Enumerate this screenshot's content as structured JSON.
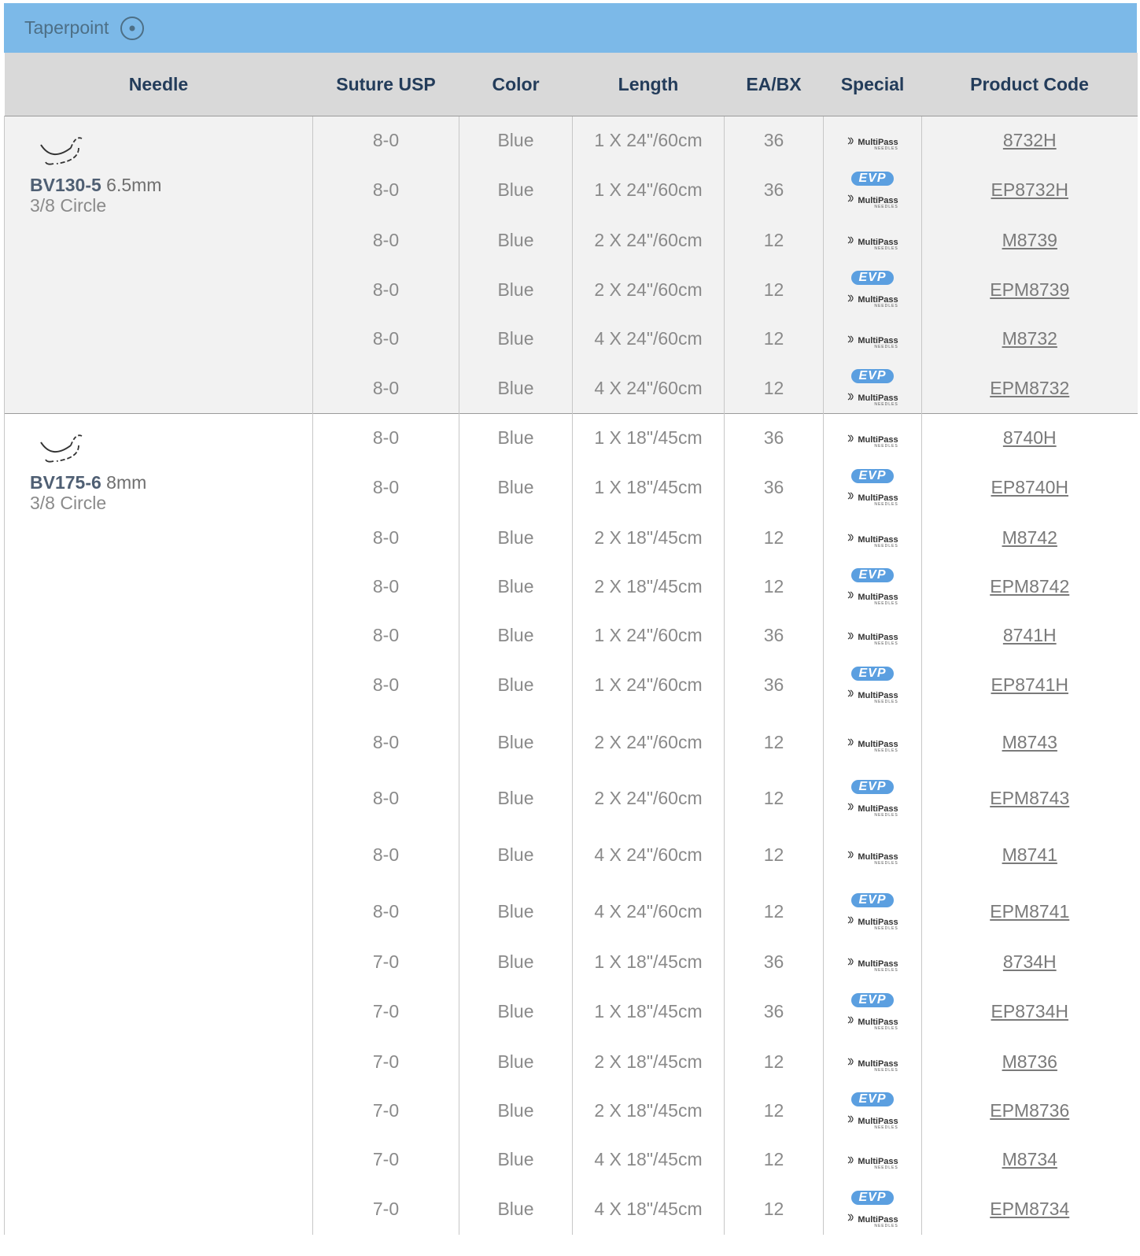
{
  "section": {
    "title": "Taperpoint",
    "icon": "target-circle-icon"
  },
  "colors": {
    "topbar": "#7cb9e8",
    "header_bg": "#d9d9d9",
    "header_text": "#233c5a",
    "evp_badge": "#5b9fe0",
    "shaded_row": "#f2f2f2"
  },
  "table": {
    "headers": {
      "needle": "Needle",
      "suture_usp": "Suture USP",
      "color": "Color",
      "length": "Length",
      "ea_bx": "EA/BX",
      "special": "Special",
      "product_code": "Product Code"
    },
    "badges": {
      "evp": "EVP",
      "multipass": "MultiPass",
      "multipass_sub": "NEEDLES"
    },
    "groups": [
      {
        "needle_code": "BV130-5",
        "needle_size": "6.5mm",
        "needle_curve": "3/8 Circle",
        "needle_icon": "needle-curve-icon",
        "shaded": true,
        "rows": [
          {
            "usp": "8-0",
            "color": "Blue",
            "length": "1 X 24\"/60cm",
            "ea": "36",
            "evp": false,
            "code": "8732H"
          },
          {
            "usp": "8-0",
            "color": "Blue",
            "length": "1 X 24\"/60cm",
            "ea": "36",
            "evp": true,
            "code": "EP8732H"
          },
          {
            "usp": "8-0",
            "color": "Blue",
            "length": "2 X 24\"/60cm",
            "ea": "12",
            "evp": false,
            "code": "M8739"
          },
          {
            "usp": "8-0",
            "color": "Blue",
            "length": "2 X 24\"/60cm",
            "ea": "12",
            "evp": true,
            "code": "EPM8739"
          },
          {
            "usp": "8-0",
            "color": "Blue",
            "length": "4 X 24\"/60cm",
            "ea": "12",
            "evp": false,
            "code": "M8732"
          },
          {
            "usp": "8-0",
            "color": "Blue",
            "length": "4 X 24\"/60cm",
            "ea": "12",
            "evp": true,
            "code": "EPM8732"
          }
        ]
      },
      {
        "needle_code": "BV175-6",
        "needle_size": "8mm",
        "needle_curve": "3/8 Circle",
        "needle_icon": "needle-curve-icon",
        "shaded": false,
        "rows": [
          {
            "usp": "8-0",
            "color": "Blue",
            "length": "1 X 18\"/45cm",
            "ea": "36",
            "evp": false,
            "code": "8740H"
          },
          {
            "usp": "8-0",
            "color": "Blue",
            "length": "1 X 18\"/45cm",
            "ea": "36",
            "evp": true,
            "code": "EP8740H"
          },
          {
            "usp": "8-0",
            "color": "Blue",
            "length": "2 X 18\"/45cm",
            "ea": "12",
            "evp": false,
            "code": "M8742"
          },
          {
            "usp": "8-0",
            "color": "Blue",
            "length": "2 X 18\"/45cm",
            "ea": "12",
            "evp": true,
            "code": "EPM8742"
          },
          {
            "usp": "8-0",
            "color": "Blue",
            "length": "1 X 24\"/60cm",
            "ea": "36",
            "evp": false,
            "code": "8741H"
          },
          {
            "usp": "8-0",
            "color": "Blue",
            "length": "1 X 24\"/60cm",
            "ea": "36",
            "evp": true,
            "code": "EP8741H"
          },
          {
            "usp": "8-0",
            "color": "Blue",
            "length": "2 X 24\"/60cm",
            "ea": "12",
            "evp": false,
            "code": "M8743"
          },
          {
            "usp": "8-0",
            "color": "Blue",
            "length": "2 X 24\"/60cm",
            "ea": "12",
            "evp": true,
            "code": "EPM8743"
          },
          {
            "usp": "8-0",
            "color": "Blue",
            "length": "4 X 24\"/60cm",
            "ea": "12",
            "evp": false,
            "code": "M8741"
          },
          {
            "usp": "8-0",
            "color": "Blue",
            "length": "4 X 24\"/60cm",
            "ea": "12",
            "evp": true,
            "code": "EPM8741"
          },
          {
            "usp": "7-0",
            "color": "Blue",
            "length": "1 X 18\"/45cm",
            "ea": "36",
            "evp": false,
            "code": "8734H"
          },
          {
            "usp": "7-0",
            "color": "Blue",
            "length": "1 X 18\"/45cm",
            "ea": "36",
            "evp": true,
            "code": "EP8734H"
          },
          {
            "usp": "7-0",
            "color": "Blue",
            "length": "2 X 18\"/45cm",
            "ea": "12",
            "evp": false,
            "code": "M8736"
          },
          {
            "usp": "7-0",
            "color": "Blue",
            "length": "2 X 18\"/45cm",
            "ea": "12",
            "evp": true,
            "code": "EPM8736"
          },
          {
            "usp": "7-0",
            "color": "Blue",
            "length": "4 X 18\"/45cm",
            "ea": "12",
            "evp": false,
            "code": "M8734"
          },
          {
            "usp": "7-0",
            "color": "Blue",
            "length": "4 X 18\"/45cm",
            "ea": "12",
            "evp": true,
            "code": "EPM8734"
          }
        ]
      }
    ]
  }
}
